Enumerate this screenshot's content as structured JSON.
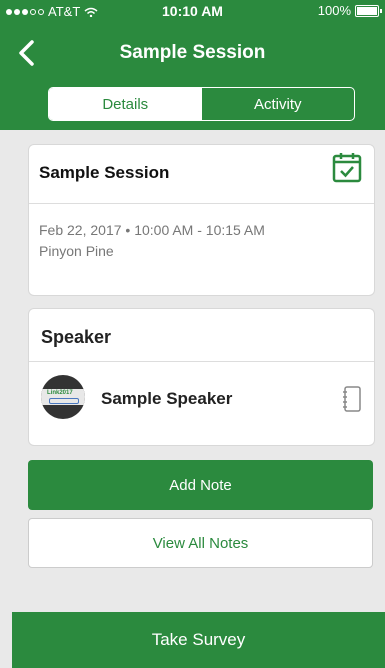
{
  "status_bar": {
    "carrier": "AT&T",
    "time": "10:10 AM",
    "battery": "100%"
  },
  "nav": {
    "title": "Sample Session"
  },
  "tabs": [
    {
      "label": "Details",
      "active": true
    },
    {
      "label": "Activity",
      "active": false
    }
  ],
  "session": {
    "title": "Sample Session",
    "datetime": "Feb 22, 2017 • 10:00 AM - 10:15 AM",
    "location": "Pinyon Pine"
  },
  "speakers": {
    "header": "Speaker",
    "items": [
      {
        "name": "Sample  Speaker",
        "avatar_text": "Link2017"
      }
    ]
  },
  "actions": {
    "add_note": "Add Note",
    "view_notes": "View All Notes"
  },
  "footer": {
    "survey": "Take Survey"
  },
  "colors": {
    "accent": "#2b8a3e"
  }
}
